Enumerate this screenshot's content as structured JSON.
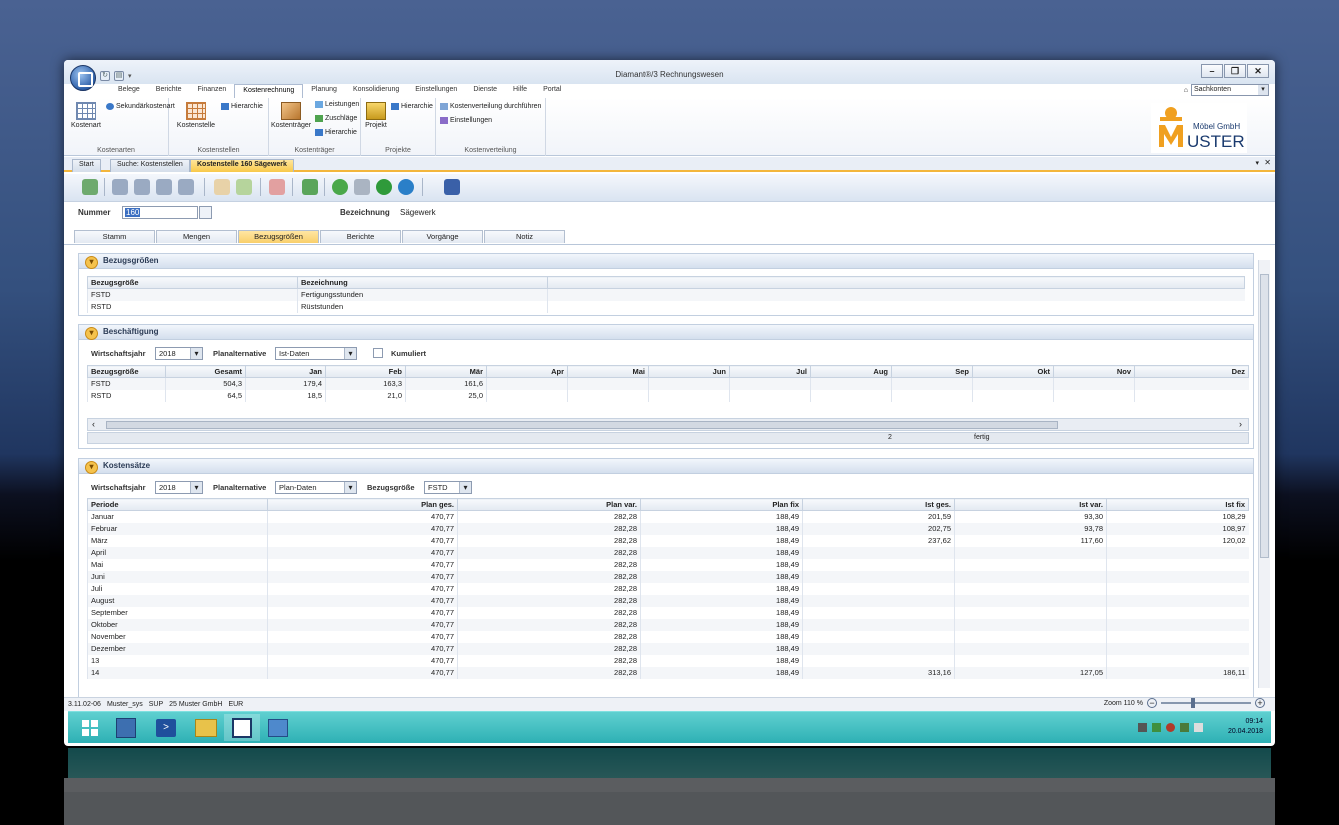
{
  "window": {
    "title": "Diamant®/3 Rechnungswesen"
  },
  "menu_tabs": [
    "Belege",
    "Berichte",
    "Finanzen",
    "Kostenrechnung",
    "Planung",
    "Konsolidierung",
    "Einstellungen",
    "Dienste",
    "Hilfe",
    "Portal"
  ],
  "menu_active": "Kostenrechnung",
  "search_box": {
    "value": "Sachkonten"
  },
  "ribbon": {
    "groups": [
      {
        "label": "Kostenarten"
      },
      {
        "label": "Kostenstellen"
      },
      {
        "label": "Kostenträger"
      },
      {
        "label": "Projekte"
      },
      {
        "label": "Kostenverteilung"
      }
    ],
    "kostenart": "Kostenart",
    "sekundaer": "Sekundärkostenart",
    "kostenstelle": "Kostenstelle",
    "hierarchie1": "Hierarchie",
    "kostentraeger": "Kostenträger",
    "leistungen": "Leistungen",
    "zuschlaege": "Zuschläge",
    "hierarchie2": "Hierarchie",
    "projekt": "Projekt",
    "hierarchie3": "Hierarchie",
    "kv_durch": "Kostenverteilung durchführen",
    "einstellungen": "Einstellungen"
  },
  "logo": {
    "small": "Möbel GmbH",
    "big": "USTER",
    "m": "M",
    "colors": {
      "orange": "#f0a020",
      "navy": "#1a3a6e"
    }
  },
  "doc_tabs": [
    "Start",
    "Suche: Kostenstellen",
    "Kostenstelle 160 Sägewerk"
  ],
  "form": {
    "nummer_label": "Nummer",
    "nummer_value": "160",
    "bez_label": "Bezeichnung",
    "bez_value": "Sägewerk"
  },
  "sub_tabs": [
    "Stamm",
    "Mengen",
    "Bezugsgrößen",
    "Berichte",
    "Vorgänge",
    "Notiz"
  ],
  "sub_tab_active": "Bezugsgrößen",
  "bezugsgroessen": {
    "title": "Bezugsgrößen",
    "headers": [
      "Bezugsgröße",
      "Bezeichnung"
    ],
    "rows": [
      [
        "FSTD",
        "Fertigungsstunden"
      ],
      [
        "RSTD",
        "Rüststunden"
      ]
    ]
  },
  "beschaeftigung": {
    "title": "Beschäftigung",
    "wj_label": "Wirtschaftsjahr",
    "wj_value": "2018",
    "pa_label": "Planalternative",
    "pa_value": "Ist-Daten",
    "kum_label": "Kumuliert",
    "headers": [
      "Bezugsgröße",
      "Gesamt",
      "Jan",
      "Feb",
      "Mär",
      "Apr",
      "Mai",
      "Jun",
      "Jul",
      "Aug",
      "Sep",
      "Okt",
      "Nov",
      "Dez"
    ],
    "rows": [
      [
        "FSTD",
        "504,3",
        "179,4",
        "163,3",
        "161,6",
        "",
        "",
        "",
        "",
        "",
        "",
        "",
        "",
        ""
      ],
      [
        "RSTD",
        "64,5",
        "18,5",
        "21,0",
        "25,0",
        "",
        "",
        "",
        "",
        "",
        "",
        "",
        "",
        ""
      ]
    ],
    "status_count": "2",
    "status_text": "fertig"
  },
  "kostensaetze": {
    "title": "Kostensätze",
    "wj_label": "Wirtschaftsjahr",
    "wj_value": "2018",
    "pa_label": "Planalternative",
    "pa_value": "Plan-Daten",
    "bg_label": "Bezugsgröße",
    "bg_value": "FSTD",
    "headers": [
      "Periode",
      "Plan ges.",
      "Plan var.",
      "Plan fix",
      "Ist ges.",
      "Ist var.",
      "Ist fix"
    ],
    "rows": [
      [
        "Januar",
        "470,77",
        "282,28",
        "188,49",
        "201,59",
        "93,30",
        "108,29"
      ],
      [
        "Februar",
        "470,77",
        "282,28",
        "188,49",
        "202,75",
        "93,78",
        "108,97"
      ],
      [
        "März",
        "470,77",
        "282,28",
        "188,49",
        "237,62",
        "117,60",
        "120,02"
      ],
      [
        "April",
        "470,77",
        "282,28",
        "188,49",
        "",
        "",
        ""
      ],
      [
        "Mai",
        "470,77",
        "282,28",
        "188,49",
        "",
        "",
        ""
      ],
      [
        "Juni",
        "470,77",
        "282,28",
        "188,49",
        "",
        "",
        ""
      ],
      [
        "Juli",
        "470,77",
        "282,28",
        "188,49",
        "",
        "",
        ""
      ],
      [
        "August",
        "470,77",
        "282,28",
        "188,49",
        "",
        "",
        ""
      ],
      [
        "September",
        "470,77",
        "282,28",
        "188,49",
        "",
        "",
        ""
      ],
      [
        "Oktober",
        "470,77",
        "282,28",
        "188,49",
        "",
        "",
        ""
      ],
      [
        "November",
        "470,77",
        "282,28",
        "188,49",
        "",
        "",
        ""
      ],
      [
        "Dezember",
        "470,77",
        "282,28",
        "188,49",
        "",
        "",
        ""
      ],
      [
        "13",
        "470,77",
        "282,28",
        "188,49",
        "",
        "",
        ""
      ],
      [
        "14",
        "470,77",
        "282,28",
        "188,49",
        "313,16",
        "127,05",
        "186,11"
      ]
    ]
  },
  "status_bar": [
    "3.11.02-06",
    "Muster_sys",
    "SUP",
    "25 Muster GmbH",
    "EUR"
  ],
  "zoom": {
    "label": "Zoom 110 %",
    "level": 110
  },
  "tray": {
    "time": "09:14",
    "date": "20.04.2018"
  }
}
